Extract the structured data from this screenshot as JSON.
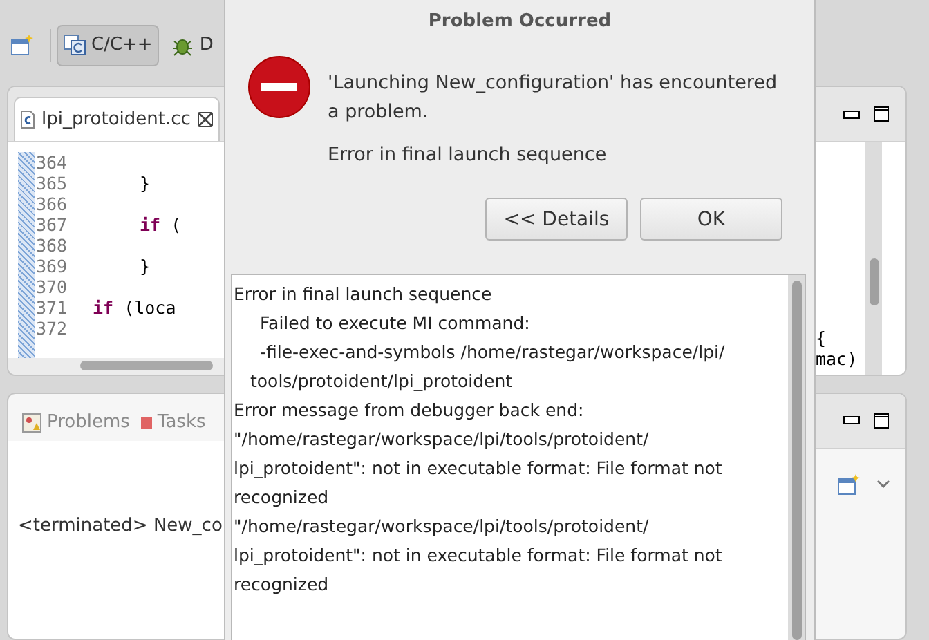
{
  "toolbar": {
    "perspectives": [
      {
        "label": "C/C++",
        "selected": true
      },
      {
        "label": "D",
        "selected": false
      }
    ]
  },
  "editor": {
    "tab": {
      "label": "lpi_protoident.cc"
    },
    "lines": [
      {
        "number": "364"
      },
      {
        "number": "365",
        "kind": "deep",
        "code": "}"
      },
      {
        "number": "366"
      },
      {
        "number": "367",
        "kind": "deep",
        "keyword": "if",
        "code": " ("
      },
      {
        "number": "368"
      },
      {
        "number": "369",
        "kind": "deep",
        "code": "}"
      },
      {
        "number": "370"
      },
      {
        "number": "371",
        "kind": "shallow",
        "keyword": "if",
        "code": " (loca"
      },
      {
        "number": "372"
      }
    ],
    "right_fragments": [
      "{",
      "mac)"
    ]
  },
  "bottom_panel": {
    "tabs": [
      {
        "label": "Problems"
      },
      {
        "label": "Tasks"
      }
    ],
    "console_text": "<terminated> New_co"
  },
  "dialog": {
    "title": "Problem Occurred",
    "message": "'Launching New_configuration' has encountered a problem.",
    "reason": "Error in final launch sequence",
    "buttons": [
      "<< Details",
      "OK"
    ],
    "details": [
      {
        "kind": "top",
        "text": "Error in final launch sequence"
      },
      {
        "kind": "sub",
        "text": "Failed to execute MI command:"
      },
      {
        "kind": "sub",
        "text": "-file-exec-and-symbols /home/rastegar/workspace/lpi/"
      },
      {
        "kind": "cont",
        "text": "tools/protoident/lpi_protoident"
      },
      {
        "kind": "top",
        "text": "Error message from debugger back end:"
      },
      {
        "kind": "top",
        "text": "\"/home/rastegar/workspace/lpi/tools/protoident/"
      },
      {
        "kind": "top",
        "text": "lpi_protoident\": not in executable format: File format not"
      },
      {
        "kind": "top",
        "text": "recognized"
      },
      {
        "kind": "top",
        "text": "\"/home/rastegar/workspace/lpi/tools/protoident/"
      },
      {
        "kind": "top",
        "text": "lpi_protoident\": not in executable format: File format not"
      },
      {
        "kind": "top",
        "text": "recognized"
      }
    ]
  }
}
